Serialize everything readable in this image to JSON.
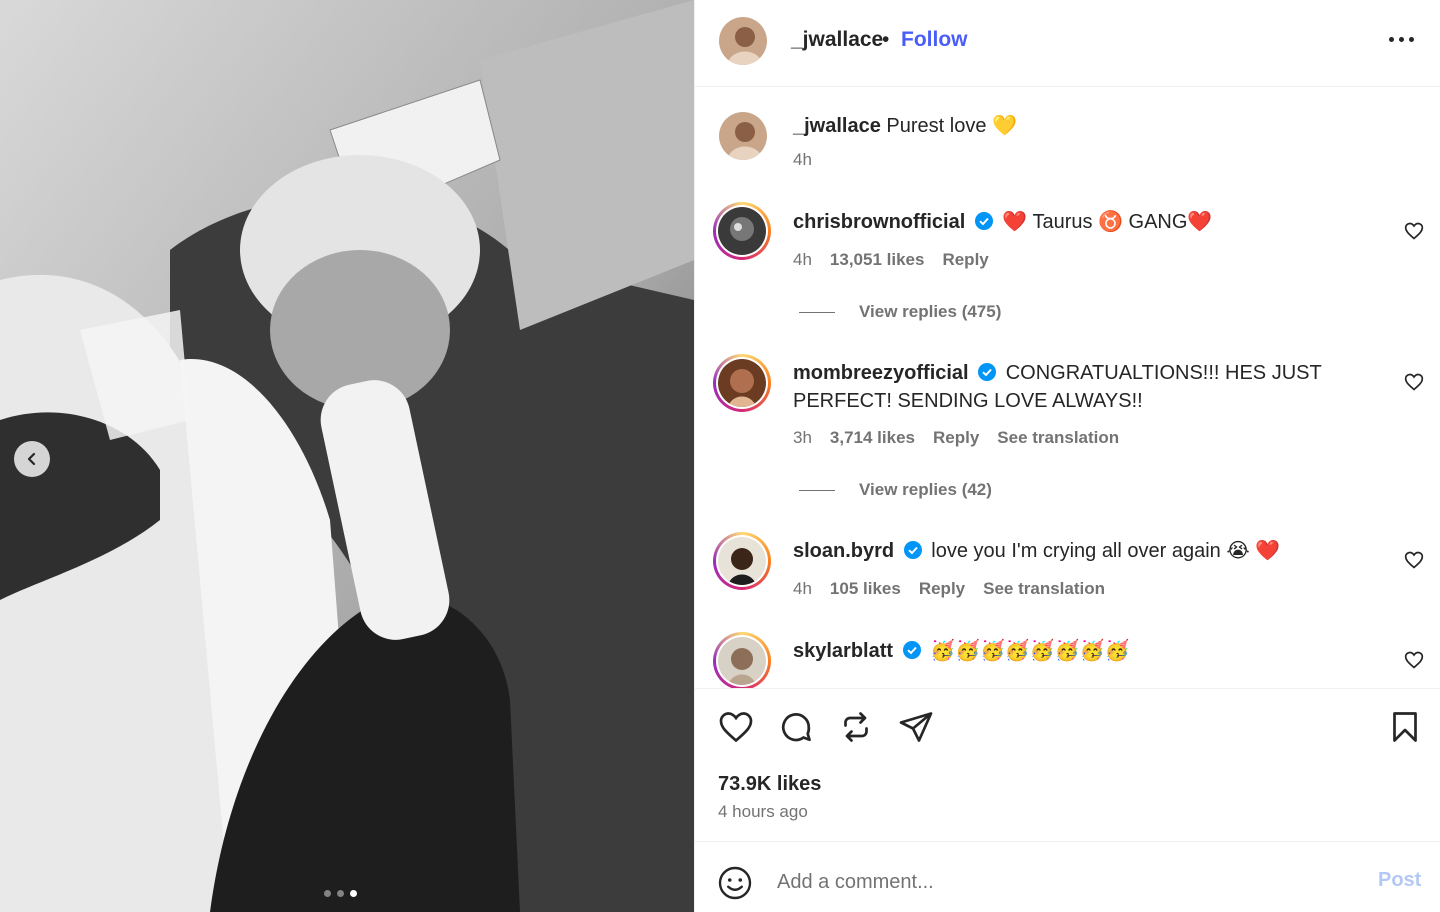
{
  "post": {
    "author": "_jwallace",
    "separator": "•",
    "follow_label": "Follow",
    "caption": "Purest love 💛",
    "caption_time": "4h",
    "likes": "73.9K likes",
    "posted_ago": "4 hours ago",
    "carousel": {
      "total": 3,
      "active_index": 3
    }
  },
  "comments": [
    {
      "user": "chrisbrownofficial",
      "verified": true,
      "text": "❤️ Taurus ♉️ GANG❤️",
      "time": "4h",
      "likes": "13,051 likes",
      "reply_label": "Reply",
      "replies_label": "View replies (475)"
    },
    {
      "user": "mombreezyofficial",
      "verified": true,
      "text_line1": "CONGRATUALTIONS!!! HES JUST",
      "text_line2": "PERFECT! SENDING LOVE ALWAYS!!",
      "time": "3h",
      "likes": "3,714 likes",
      "reply_label": "Reply",
      "translation_label": "See translation",
      "replies_label": "View replies (42)"
    },
    {
      "user": "sloan.byrd",
      "verified": true,
      "text": "love you I'm crying all over again 😭 ❤️",
      "time": "4h",
      "likes": "105 likes",
      "reply_label": "Reply",
      "translation_label": "See translation"
    },
    {
      "user": "skylarblatt",
      "verified": true,
      "text": "🥳🥳🥳🥳🥳🥳🥳🥳"
    }
  ],
  "composer": {
    "placeholder": "Add a comment...",
    "post_label": "Post"
  },
  "colors": {
    "link_blue": "#4a5df9",
    "muted": "#737373",
    "verified": "#0095f6",
    "post_disabled": "#b3c8f7"
  },
  "icons": [
    "chevron-left-icon",
    "more-icon",
    "heart-icon",
    "comment-icon",
    "repost-icon",
    "share-icon",
    "bookmark-icon",
    "emoji-icon",
    "verified-badge-icon"
  ]
}
